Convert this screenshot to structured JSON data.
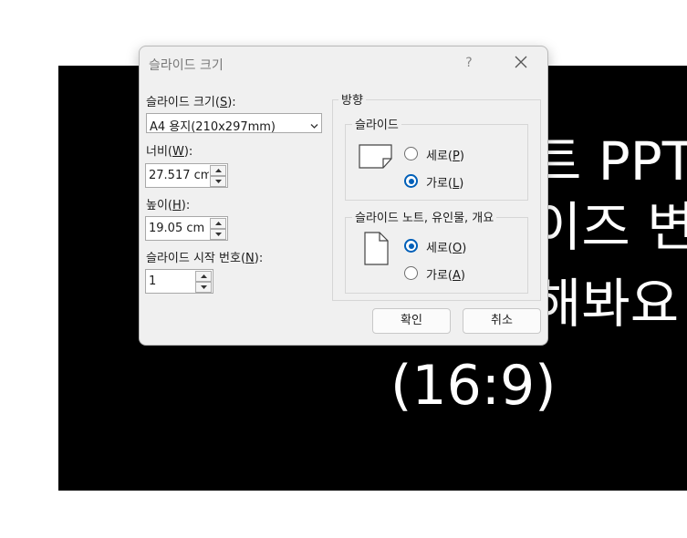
{
  "slide": {
    "lines": [
      "트 PPT",
      "이즈 변",
      "해봐요",
      "(16:9)"
    ]
  },
  "dialog": {
    "title": "슬라이드 크기",
    "help_label": "?",
    "size_label_prefix": "슬라이드 크기(",
    "size_label_key": "S",
    "size_label_suffix": "):",
    "size_value": "A4 용지(210x297mm)",
    "width_label_prefix": "너비(",
    "width_label_key": "W",
    "width_label_suffix": "):",
    "width_value": "27.517 cm",
    "height_label_prefix": "높이(",
    "height_label_key": "H",
    "height_label_suffix": "):",
    "height_value": "19.05 cm",
    "start_label_prefix": "슬라이드 시작 번호(",
    "start_label_key": "N",
    "start_label_suffix": "):",
    "start_value": "1",
    "orientation": {
      "title": "방향",
      "slides": {
        "title": "슬라이드",
        "portrait_prefix": "세로(",
        "portrait_key": "P",
        "portrait_suffix": ")",
        "landscape_prefix": "가로(",
        "landscape_key": "L",
        "landscape_suffix": ")",
        "selected": "landscape"
      },
      "notes": {
        "title": "슬라이드 노트, 유인물, 개요",
        "portrait_prefix": "세로(",
        "portrait_key": "O",
        "portrait_suffix": ")",
        "landscape_prefix": "가로(",
        "landscape_key": "A",
        "landscape_suffix": ")",
        "selected": "portrait"
      }
    },
    "ok_label": "확인",
    "cancel_label": "취소"
  },
  "colors": {
    "accent": "#005fb8",
    "slide_bg": "#000000",
    "dialog_bg": "#f0f0f0"
  }
}
